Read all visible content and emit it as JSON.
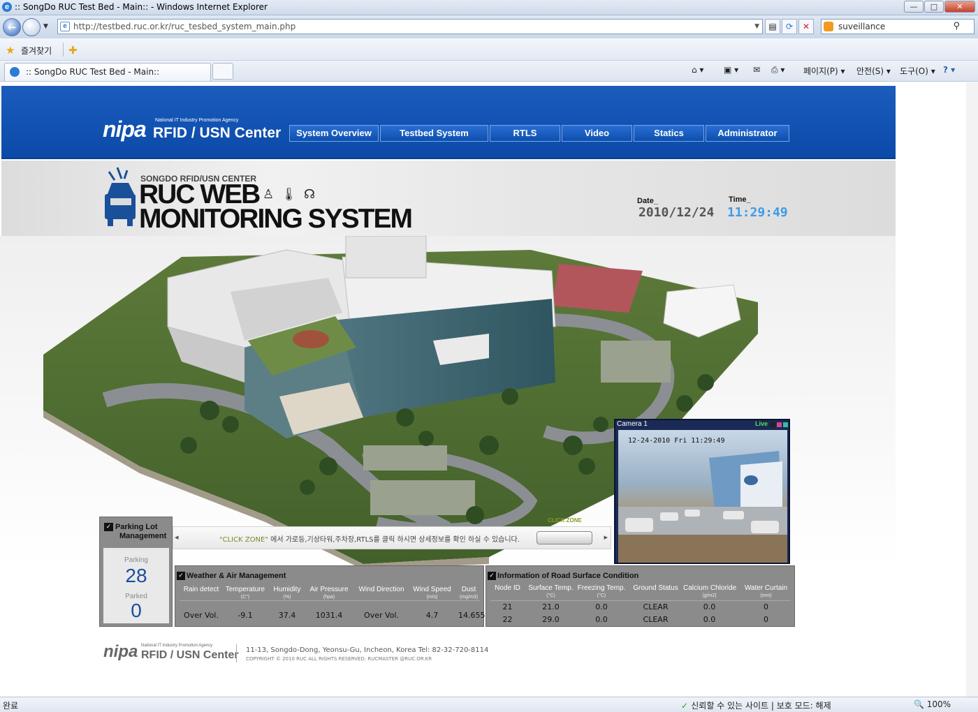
{
  "window": {
    "title": ":: SongDo RUC Test Bed - Main:: - Windows Internet Explorer",
    "btn_min": "—",
    "btn_max": "□",
    "btn_close": "✕"
  },
  "address": {
    "url": "http://testbed.ruc.or.kr/ruc_tesbed_system_main.php",
    "search_value": "suveillance"
  },
  "favorites": {
    "label": "즐겨찾기"
  },
  "tab": {
    "label": ":: SongDo RUC Test Bed - Main::"
  },
  "commands": {
    "page": "페이지(P) ▾",
    "safety": "안전(S) ▾",
    "tools": "도구(O) ▾",
    "help": "? ▾"
  },
  "site": {
    "logo": {
      "nipa": "nipa",
      "agency": "National IT Industry Promotion Agency",
      "center": "RFID / USN Center"
    },
    "nav": [
      {
        "label": "System Overview",
        "w": 128
      },
      {
        "label": "Testbed System",
        "w": 155
      },
      {
        "label": "RTLS",
        "w": 101
      },
      {
        "label": "Video",
        "w": 101
      },
      {
        "label": "Statics",
        "w": 101
      },
      {
        "label": "Administrator",
        "w": 120
      }
    ],
    "banner": {
      "subtitle": "SONGDO RFID/USN CENTER",
      "line1": "RUC WEB",
      "line2": "MONITORING SYSTEM",
      "icons": "♙🌡☊"
    },
    "date_label": "Date_",
    "date_value": "2010/12/24",
    "time_label": "Time_",
    "time_value": "11:29:49"
  },
  "camera": {
    "title": "Camera 1",
    "live": "Live",
    "stamp": "12-24-2010 Fri 11:29:49"
  },
  "parking": {
    "title_line1": "Parking Lot",
    "title_line2": "Management",
    "parking_label": "Parking",
    "parking_value": "28",
    "parked_label": "Parked",
    "parked_value": "0"
  },
  "zone": {
    "label": "CLICK ZONE",
    "text_hl": "\"CLICK ZONE\"",
    "text": " 에서 가로등,기상타워,주차장,RTLS를 클릭 하시면 상세정보를 확인 하실 수 있습니다."
  },
  "weather": {
    "title": "Weather & Air Management",
    "columns": [
      {
        "label": "Rain detect",
        "unit": ""
      },
      {
        "label": "Temperature",
        "unit": "(C°)"
      },
      {
        "label": "Humidity",
        "unit": "(%)"
      },
      {
        "label": "Air Pressure",
        "unit": "(hpa)"
      },
      {
        "label": "Wind Direction",
        "unit": ""
      },
      {
        "label": "Wind Speed",
        "unit": "(m/s)"
      },
      {
        "label": "Dust",
        "unit": "(mg/m3)"
      }
    ],
    "values": [
      "Over Vol.",
      "-9.1",
      "37.4",
      "1031.4",
      "Over Vol.",
      "4.7",
      "14.655"
    ]
  },
  "road": {
    "title": "Information of Road Surface Condition",
    "columns": [
      {
        "label": "Node ID",
        "unit": ""
      },
      {
        "label": "Surface Temp.",
        "unit": "(°C)"
      },
      {
        "label": "Freezing Temp.",
        "unit": "(°C)"
      },
      {
        "label": "Ground Status",
        "unit": ""
      },
      {
        "label": "Calcium Chloride",
        "unit": "(g/m2)"
      },
      {
        "label": "Water Curtain",
        "unit": "(mm)"
      }
    ],
    "rows": [
      [
        "21",
        "21.0",
        "0.0",
        "CLEAR",
        "0.0",
        "0"
      ],
      [
        "22",
        "29.0",
        "0.0",
        "CLEAR",
        "0.0",
        "0"
      ]
    ]
  },
  "footer": {
    "nipa": "nipa",
    "agency": "National IT Industry Promotion Agency",
    "center": "RFID / USN Center",
    "address": "11-13, Songdo-Dong, Yeonsu-Gu, Incheon, Korea Tel: 82-32-720-8114",
    "copyright": "COPYRIGHT © 2010 RUC ALL RIGHTS RESERVED. RUCMASTER @RUC.OR.KR"
  },
  "status": {
    "left": "완료",
    "trust": "신뢰할 수 있는 사이트 | 보호 모드: 해제",
    "zoom": "🔍 100%"
  }
}
